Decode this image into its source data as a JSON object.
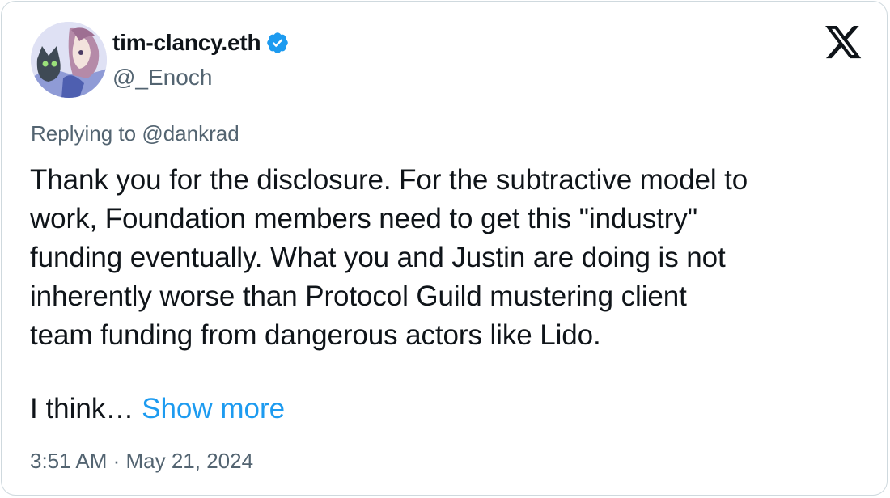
{
  "author": {
    "display_name": "tim-clancy.eth",
    "handle": "@_Enoch",
    "verified": true,
    "avatar_icon": "anime-avatar-icon"
  },
  "brand": {
    "logo_icon": "x-logo-icon"
  },
  "reply": {
    "prefix": "Replying to",
    "handle": "@dankrad"
  },
  "tweet": {
    "text": "Thank you for the disclosure. For the subtractive model to\nwork, Foundation members need to get this \"industry\"\nfunding eventually. What you and Justin are doing is not\ninherently worse than Protocol Guild mustering client\nteam funding from dangerous actors like Lido.",
    "truncated_text": "I think…",
    "show_more_label": "Show more"
  },
  "meta": {
    "timestamp": "3:51 AM · May 21, 2024"
  },
  "colors": {
    "text_primary": "#0f1419",
    "text_secondary": "#536471",
    "link": "#1d9bf0",
    "verified": "#1d9bf0",
    "border": "#cfd9de"
  }
}
